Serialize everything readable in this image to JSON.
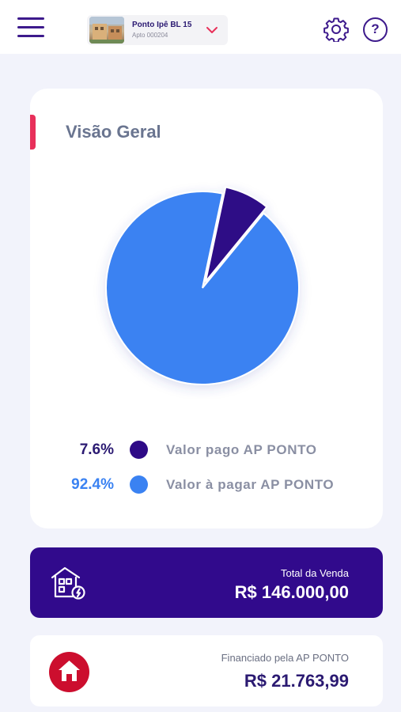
{
  "header": {
    "property_name": "Ponto Ipê BL 15",
    "property_unit": "Apto 000204",
    "menu_icon": "hamburger-menu-icon",
    "settings_icon": "gear-icon",
    "help_icon": "help-icon",
    "help_symbol": "?"
  },
  "overview": {
    "title": "Visão Geral",
    "accent_color": "#e8305a",
    "legend": [
      {
        "percent": "7.6%",
        "label": "Valor pago AP PONTO",
        "color": "#2e0a86"
      },
      {
        "percent": "92.4%",
        "label": "Valor à pagar AP PONTO",
        "color": "#3a82f2"
      }
    ]
  },
  "chart_data": {
    "type": "pie",
    "slices": [
      {
        "label": "Valor pago AP PONTO",
        "value": 7.6,
        "color": "#2e0a86",
        "exploded": true
      },
      {
        "label": "Valor à pagar AP PONTO",
        "value": 92.4,
        "color": "#3a82f2",
        "exploded": false
      }
    ]
  },
  "total_sale": {
    "label": "Total da Venda",
    "value": "R$ 146.000,00",
    "icon": "house-money-icon",
    "background": "#310a8c"
  },
  "financed": {
    "label": "Financiado pela AP PONTO",
    "value": "R$ 21.763,99",
    "icon": "home-icon",
    "icon_color": "#cc0e2e"
  }
}
